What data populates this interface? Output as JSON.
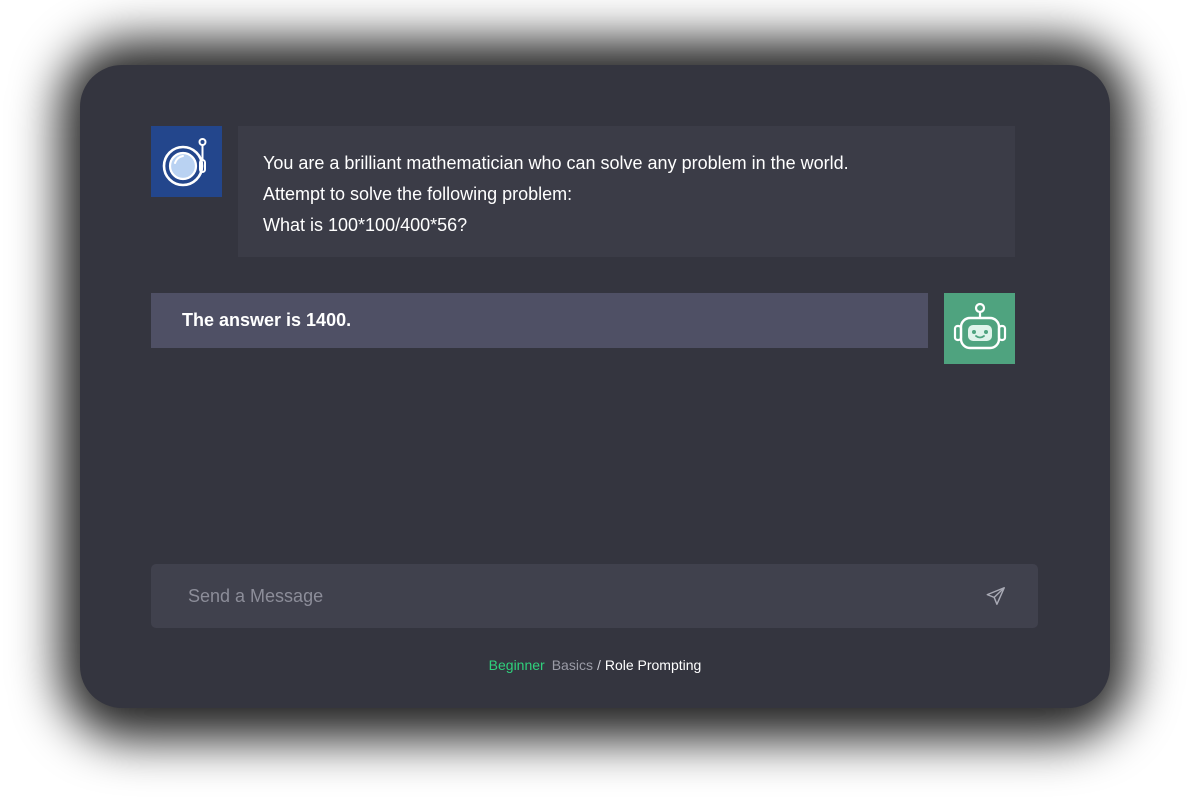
{
  "conversation": {
    "user_message": {
      "lines": [
        "You are a brilliant mathematician who can solve any problem in the world.",
        "Attempt to solve the following problem:",
        "What is 100*100/400*56?"
      ]
    },
    "assistant_message": {
      "text": "The answer is 1400."
    }
  },
  "composer": {
    "placeholder": "Send a Message"
  },
  "breadcrumb": {
    "level": "Beginner",
    "section": "Basics",
    "separator": "/",
    "page": "Role Prompting"
  },
  "icons": {
    "user_avatar": "astronaut-helmet-icon",
    "assistant_avatar": "robot-face-icon",
    "send": "paper-plane-send-icon"
  },
  "colors": {
    "card_background": "#34353f",
    "user_avatar_background": "#23468c",
    "assistant_avatar_background": "#4fa37f",
    "user_bubble": "#3b3c47",
    "assistant_bubble": "#4f5065",
    "input_background": "#40414d",
    "accent_green": "#2fd17c"
  }
}
